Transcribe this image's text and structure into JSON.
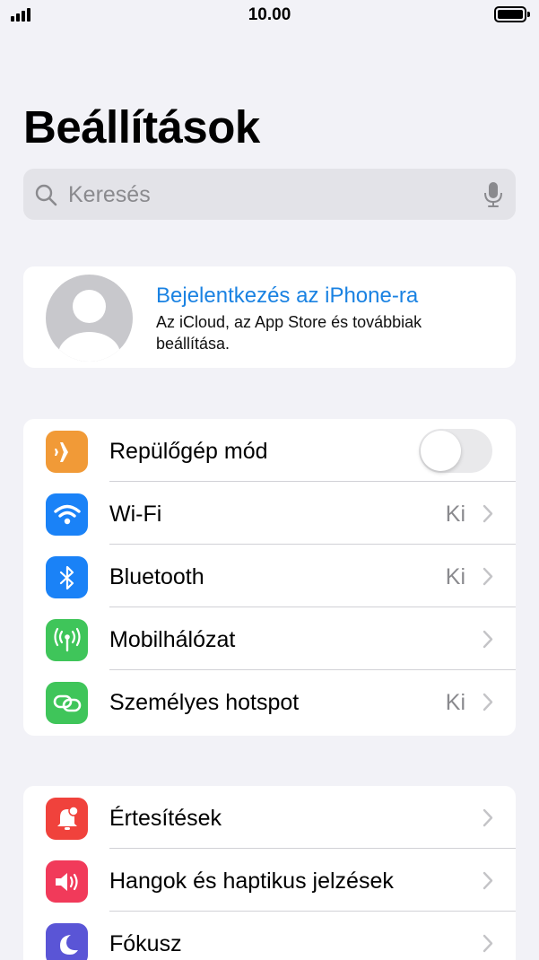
{
  "status_bar": {
    "time": "10.00"
  },
  "page_title": "Beállítások",
  "search": {
    "placeholder": "Keresés"
  },
  "account": {
    "title": "Bejelentkezés az iPhone-ra",
    "subtitle": "Az iCloud, az App Store és továbbiak beállítása."
  },
  "connectivity": [
    {
      "label": "Repülőgép mód",
      "icon": "airplane-icon",
      "color": "#f19a37",
      "toggle": false
    },
    {
      "label": "Wi-Fi",
      "icon": "wifi-icon",
      "color": "#1a82f7",
      "value": "Ki"
    },
    {
      "label": "Bluetooth",
      "icon": "bluetooth-icon",
      "color": "#1a82f7",
      "value": "Ki"
    },
    {
      "label": "Mobilhálózat",
      "icon": "antenna-icon",
      "color": "#3fc55a",
      "value": ""
    },
    {
      "label": "Személyes hotspot",
      "icon": "hotspot-icon",
      "color": "#3fc55a",
      "value": "Ki"
    }
  ],
  "notifications": [
    {
      "label": "Értesítések",
      "icon": "bell-icon",
      "color": "#f0423c"
    },
    {
      "label": "Hangok és haptikus jelzések",
      "icon": "speaker-icon",
      "color": "#f13a5a"
    },
    {
      "label": "Fókusz",
      "icon": "moon-icon",
      "color": "#5a55d6"
    }
  ]
}
